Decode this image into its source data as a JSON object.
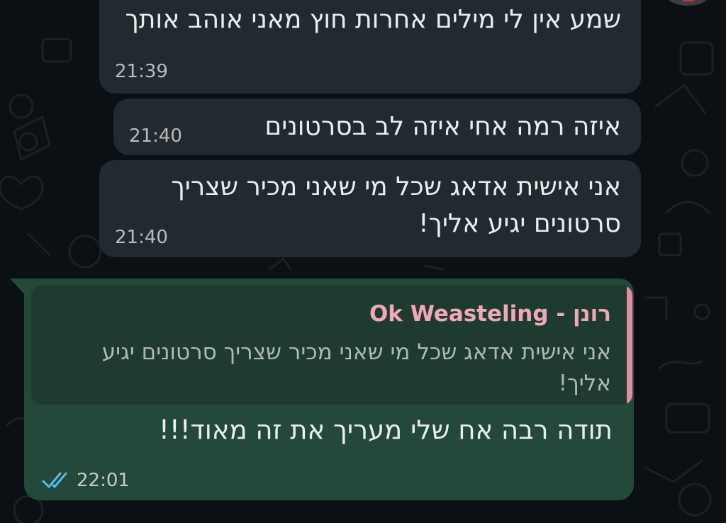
{
  "messages": {
    "incoming": [
      {
        "text": "שמע אין לי מילים אחרות חוץ מאני אוהב אותך",
        "time": "21:39"
      },
      {
        "text": "איזה רמה אחי איזה לב בסרטונים",
        "time": "21:40"
      },
      {
        "text": "אני אישית אדאג שכל מי שאני מכיר שצריך סרטונים יגיע אליך!",
        "time": "21:40"
      }
    ],
    "outgoing": {
      "quoted_author": "רונן - Ok Weasteling",
      "quoted_text": "אני אישית אדאג שכל מי שאני מכיר שצריך סרטונים יגיע אליך!",
      "text": "תודה רבה אח שלי מעריך את זה מאוד!!!",
      "time": "22:01",
      "status_icon": "double-check-read-icon"
    }
  },
  "colors": {
    "background": "#0b1014",
    "incoming_bubble": "#232a2f",
    "outgoing_bubble": "#24493a",
    "quote_accent": "#e48aa6",
    "read_ticks": "#53bdeb"
  }
}
